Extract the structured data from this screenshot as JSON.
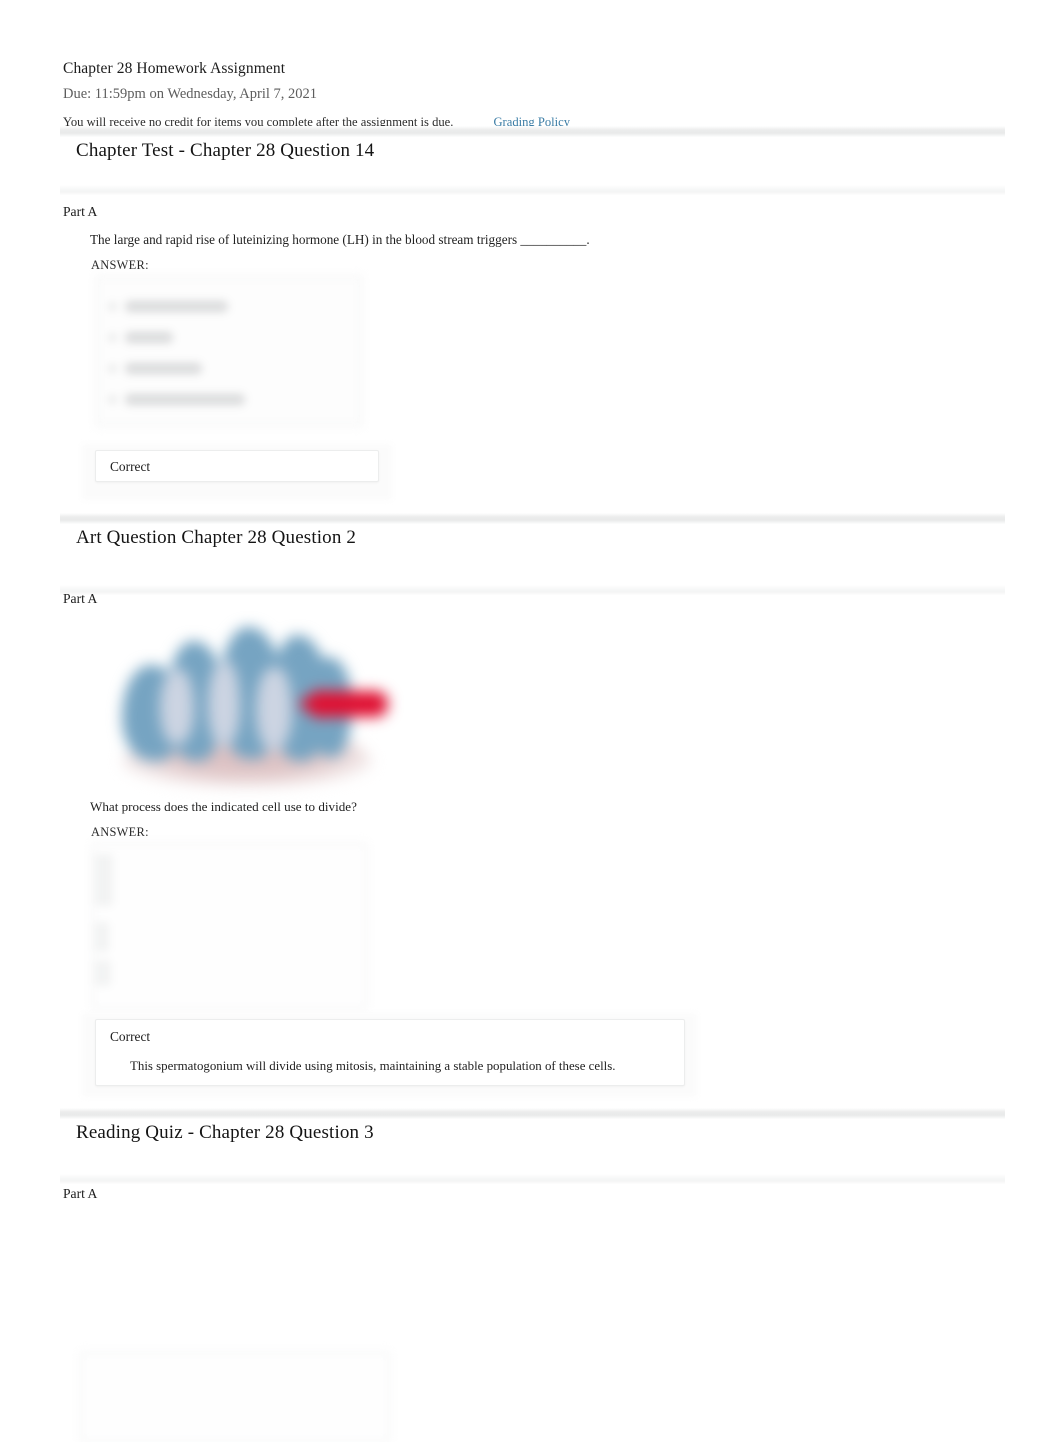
{
  "assignment": {
    "title": "Chapter 28 Homework Assignment",
    "due": "Due: 11:59pm on Wednesday, April 7, 2021",
    "notice": "You will receive no credit for items you complete after the assignment is due.",
    "grading_policy_link": "Grading Policy"
  },
  "sections": [
    {
      "heading": "Chapter Test - Chapter 28 Question 14",
      "part_label": "Part A",
      "question": "The large and rapid rise of luteinizing hormone (LH) in the blood stream triggers __________.",
      "answer_label": "ANSWER:",
      "choices_redacted": true,
      "choice_count": 4,
      "feedback_title": "Correct",
      "feedback_text": ""
    },
    {
      "heading": "Art Question Chapter 28 Question 2",
      "part_label": "Part A",
      "figure_caption": "What process does the indicated cell use to divide?",
      "answer_label": "ANSWER:",
      "choices_redacted": true,
      "feedback_title": "Correct",
      "feedback_text": "This spermatogonium will divide using mitosis, maintaining a stable population of these cells."
    },
    {
      "heading": "Reading Quiz - Chapter 28 Question 3",
      "part_label": "Part A",
      "choices_redacted": true
    }
  ],
  "colors": {
    "link": "#3a7ca5",
    "band": "#e9eaea",
    "text": "#1a1a1a",
    "muted": "#5d5d5d",
    "figure_cell": "#76a4c2",
    "figure_pale": "#ccd4e2",
    "figure_arrow": "#df1133",
    "figure_tissue": "#d9bcbe"
  }
}
